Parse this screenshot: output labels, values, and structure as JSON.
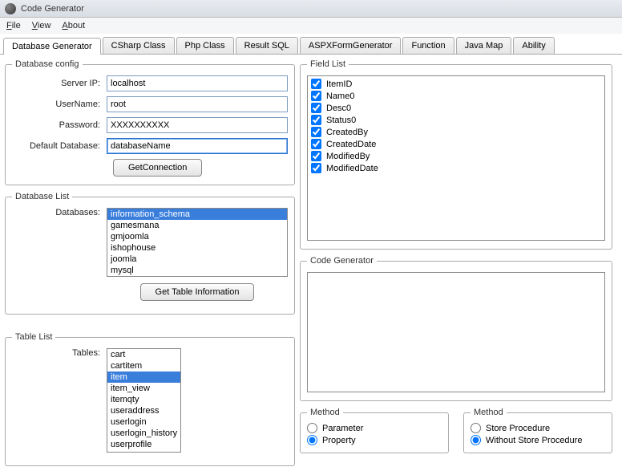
{
  "window": {
    "title": "Code Generator"
  },
  "menu": {
    "file": "File",
    "view": "View",
    "about": "About"
  },
  "tabs": [
    {
      "label": "Database Generator"
    },
    {
      "label": "CSharp Class"
    },
    {
      "label": "Php Class"
    },
    {
      "label": "Result SQL"
    },
    {
      "label": "ASPXFormGenerator"
    },
    {
      "label": "Function"
    },
    {
      "label": "Java Map"
    },
    {
      "label": "Ability"
    }
  ],
  "dbconfig": {
    "legend": "Database config",
    "server_ip_label": "Server IP:",
    "server_ip": "localhost",
    "username_label": "UserName:",
    "username": "root",
    "password_label": "Password:",
    "password": "XXXXXXXXXX",
    "default_db_label": "Default Database:",
    "default_db": "databaseName",
    "get_connection": "GetConnection"
  },
  "dblist": {
    "legend": "Database List",
    "label": "Databases:",
    "items": [
      {
        "name": "information_schema",
        "selected": true
      },
      {
        "name": "gamesmana"
      },
      {
        "name": "gmjoomla"
      },
      {
        "name": "ishophouse"
      },
      {
        "name": "joomla"
      },
      {
        "name": "mysql"
      }
    ],
    "get_table_info": "Get Table Information"
  },
  "tablelist": {
    "legend": "Table List",
    "label": "Tables:",
    "items": [
      {
        "name": "cart"
      },
      {
        "name": "cartitem"
      },
      {
        "name": "item",
        "selected": true
      },
      {
        "name": "item_view"
      },
      {
        "name": "itemqty"
      },
      {
        "name": "useraddress"
      },
      {
        "name": "userlogin"
      },
      {
        "name": "userlogin_history"
      },
      {
        "name": "userprofile"
      }
    ]
  },
  "fieldlist": {
    "legend": "Field List",
    "items": [
      {
        "name": "ItemID"
      },
      {
        "name": "Name0"
      },
      {
        "name": "Desc0"
      },
      {
        "name": "Status0"
      },
      {
        "name": "CreatedBy"
      },
      {
        "name": "CreatedDate"
      },
      {
        "name": "ModifiedBy"
      },
      {
        "name": "ModifiedDate"
      }
    ]
  },
  "codegen": {
    "legend": "Code Generator"
  },
  "method1": {
    "legend": "Method",
    "parameter": "Parameter",
    "property": "Property"
  },
  "method2": {
    "legend": "Method",
    "sp": "Store Procedure",
    "wsp": "Without Store Procedure"
  }
}
